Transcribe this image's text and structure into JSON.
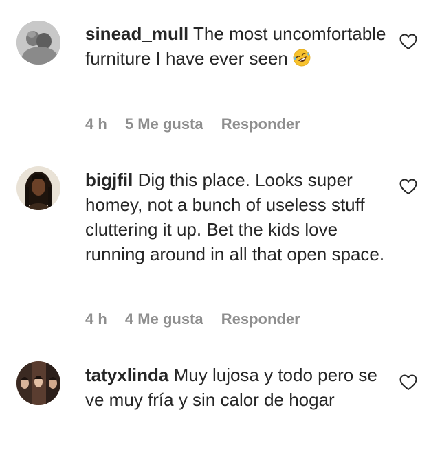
{
  "comments": [
    {
      "username": "sinead_mull",
      "text": "The most uncomfortable furniture I have ever seen",
      "emoji": "rolling-on-floor-laughing-emoji",
      "time": "4 h",
      "likes": "5 Me gusta",
      "reply": "Responder"
    },
    {
      "username": "bigjfil",
      "text": "Dig this place. Looks super homey, not a bunch of useless stuff cluttering it up. Bet the kids love running around in all that open space.",
      "time": "4 h",
      "likes": "4 Me gusta",
      "reply": "Responder"
    },
    {
      "username": "tatyxlinda",
      "text": "Muy lujosa y todo pero se ve muy fría y sin calor de hogar"
    }
  ],
  "icons": {
    "like": "heart-outline-icon"
  },
  "colors": {
    "text": "#262626",
    "meta": "#8e8e8e",
    "background": "#ffffff"
  }
}
